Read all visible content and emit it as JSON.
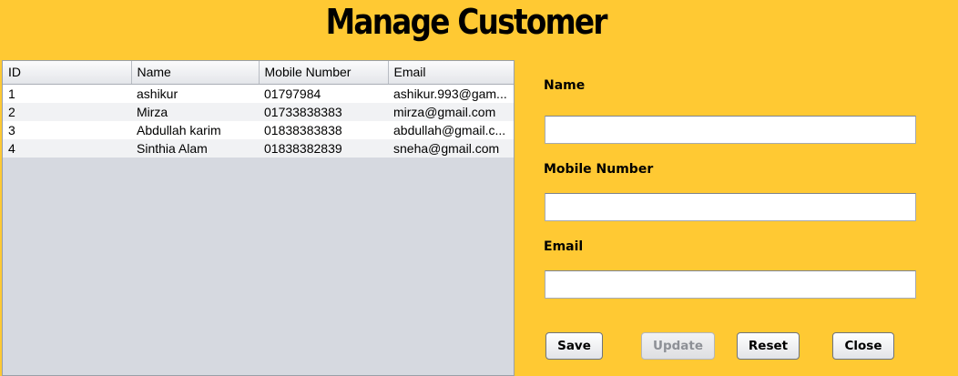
{
  "window": {
    "title": "Manage Customer"
  },
  "table": {
    "columns": [
      "ID",
      "Name",
      "Mobile Number",
      "Email"
    ],
    "rows": [
      [
        "1",
        "ashikur",
        "01797984",
        "ashikur.993@gam..."
      ],
      [
        "2",
        "Mirza",
        "01733838383",
        "mirza@gmail.com"
      ],
      [
        "3",
        "Abdullah karim",
        "01838383838",
        "abdullah@gmail.c..."
      ],
      [
        "4",
        "Sinthia Alam",
        "01838382839",
        "sneha@gmail.com"
      ]
    ]
  },
  "form": {
    "name_label": "Name",
    "name_value": "",
    "mobile_label": "Mobile Number",
    "mobile_value": "",
    "email_label": "Email",
    "email_value": ""
  },
  "buttons": {
    "save": "Save",
    "update": "Update",
    "update_enabled": false,
    "reset": "Reset",
    "close": "Close"
  },
  "colors": {
    "background": "#ffc933",
    "table_background": "#d6d9e0"
  }
}
